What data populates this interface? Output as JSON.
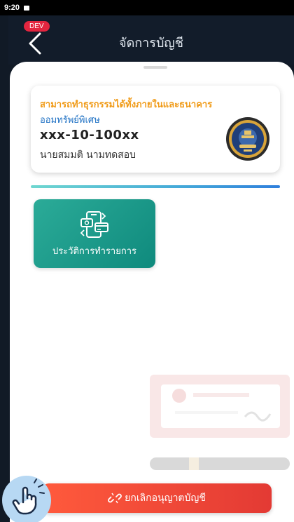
{
  "status_bar": {
    "time": "9:20"
  },
  "app_bar": {
    "title": "จัดการบัญชี",
    "env_badge": "DEV",
    "back_icon": "chevron-left-icon"
  },
  "account": {
    "permission_text": "สามารถทำธุรกรรมได้ทั้งภายในและธนาคาร",
    "account_type": "ออมทรัพย์พิเศษ",
    "account_number": "xxx-10-100xx",
    "holder_name": "นายสมมติ นามทดสอบ",
    "logo_icon": "bank-seal-logo"
  },
  "colors": {
    "header_bg": "#121c2a",
    "permission_orange": "#f09a16",
    "account_type_blue": "#1c6fc3",
    "tile_teal": "#14917f",
    "cancel_red": "#e8453a",
    "dev_badge_red": "#e3253f"
  },
  "menu": {
    "history_label": "ประวัติการทำรายการ",
    "history_icon": "transaction-history-icon"
  },
  "actions": {
    "cancel_label": "ยกเลิกอนุญาตบัญชี",
    "cancel_icon": "unlink-icon"
  },
  "overlay": {
    "touch_icon": "tap-hand-icon"
  }
}
